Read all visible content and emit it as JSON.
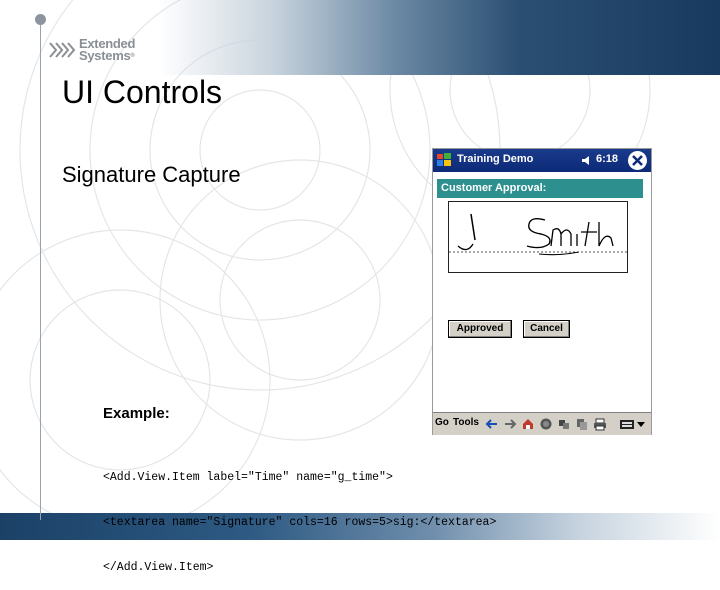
{
  "logo": {
    "line1": "Extended",
    "line2": "Systems",
    "reg": "®"
  },
  "slide": {
    "title": "UI Controls",
    "subtitle": "Signature Capture",
    "example_label": "Example:",
    "code_lines": [
      "<Add.View.Item label=\"Time\" name=\"g_time\">",
      "<textarea name=\"Signature\" cols=16 rows=5>sig:</textarea>",
      "</Add.View.Item>"
    ]
  },
  "pda": {
    "app_title": "Training Demo",
    "clock": "6:18",
    "approval_label": "Customer Approval:",
    "approved_button": "Approved",
    "cancel_button": "Cancel",
    "menu": [
      "Go",
      "Tools"
    ],
    "colors": {
      "titlebar": "#0c2a78",
      "approval_bar": "#2e8f8f",
      "toolbar": "#d4d0c8"
    }
  }
}
